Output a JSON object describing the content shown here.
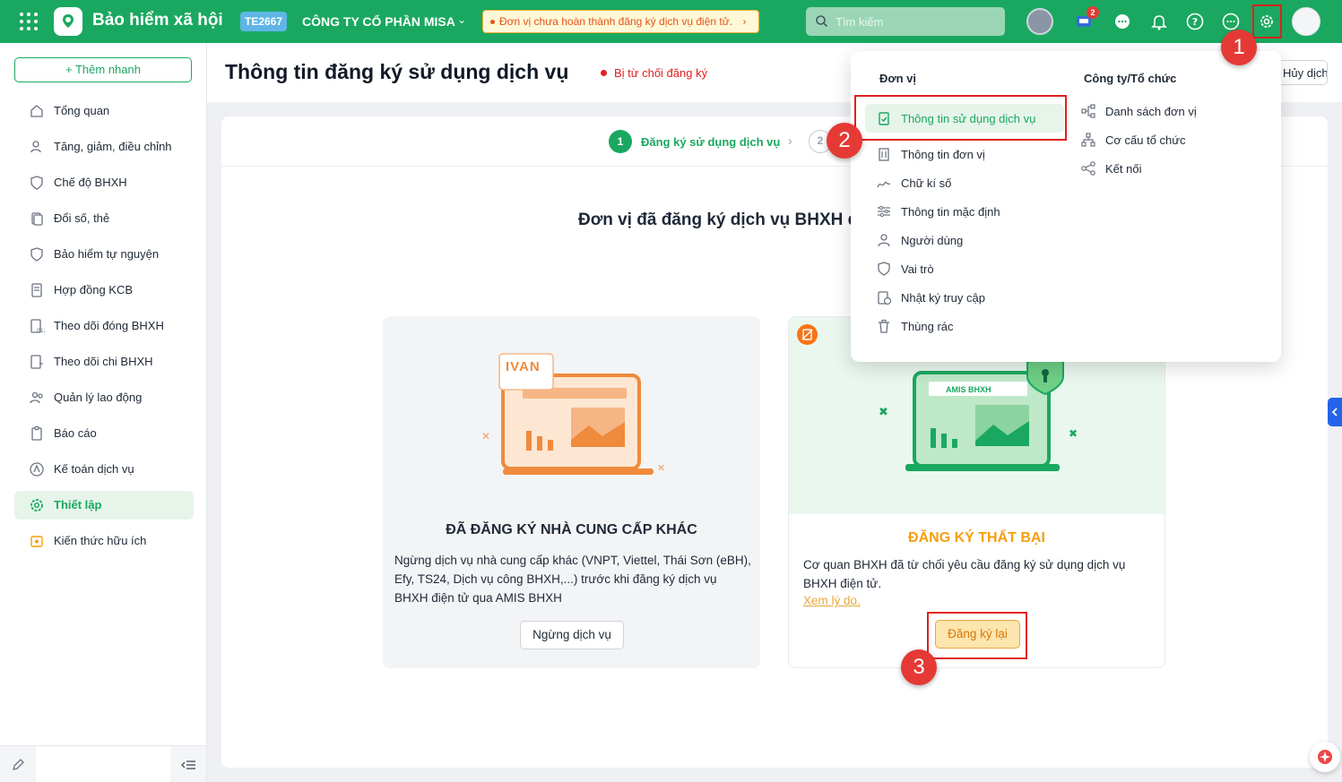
{
  "topbar": {
    "app_title": "Bảo hiểm xã hội",
    "org_code": "TE2667",
    "org_name": "CÔNG TY CỔ PHẦN MISA",
    "warning": "Đơn vị chưa hoàn thành đăng ký dịch vụ điện tử.",
    "search_placeholder": "Tìm kiếm",
    "cart_badge": "2",
    "brand_color": "#1aa860"
  },
  "sidebar": {
    "quick_add": "Thêm nhanh",
    "items": [
      {
        "label": "Tổng quan",
        "icon": "home-icon"
      },
      {
        "label": "Tăng, giảm, điều chỉnh",
        "icon": "user-adjust-icon"
      },
      {
        "label": "Chế độ BHXH",
        "icon": "shield-heart-icon"
      },
      {
        "label": "Đổi số, thẻ",
        "icon": "card-swap-icon"
      },
      {
        "label": "Bảo hiểm tự nguyện",
        "icon": "shield-icon"
      },
      {
        "label": "Hợp đồng KCB",
        "icon": "contract-icon"
      },
      {
        "label": "Theo dõi đóng BHXH",
        "icon": "payment-track-icon"
      },
      {
        "label": "Theo dõi chi BHXH",
        "icon": "expense-track-icon"
      },
      {
        "label": "Quản lý lao động",
        "icon": "people-icon"
      },
      {
        "label": "Báo cáo",
        "icon": "report-icon"
      },
      {
        "label": "Kế toán dịch vụ",
        "icon": "accounting-icon"
      },
      {
        "label": "Thiết lập",
        "icon": "gear-icon"
      },
      {
        "label": "Kiến thức hữu ích",
        "icon": "knowledge-icon"
      }
    ]
  },
  "header": {
    "title": "Thông tin đăng ký sử dụng dịch vụ",
    "status": "Bị từ chối đăng ký",
    "right_button": "Hủy dịch vụ"
  },
  "stepper": {
    "step1_num": "1",
    "step1_label": "Đăng ký sử dụng dịch vụ",
    "step2_num": "2"
  },
  "content": {
    "heading": "Đơn vị đã đăng ký dịch vụ BHXH điện tử",
    "left_panel": {
      "tag": "IVAN",
      "title": "ĐÃ ĐĂNG KÝ NHÀ CUNG CẤP KHÁC",
      "text": "Ngừng dịch vụ nhà cung cấp khác (VNPT, Viettel, Thái Sơn (eBH), Efy, TS24, Dịch vụ công BHXH,...) trước khi đăng ký dịch vụ BHXH điện tử qua AMIS BHXH",
      "button": "Ngừng dịch vụ"
    },
    "right_panel": {
      "screen_label": "AMIS BHXH",
      "title": "ĐĂNG KÝ THẤT BẠI",
      "text": "Cơ quan BHXH đã từ chối yêu cầu đăng ký sử dụng dịch vụ BHXH điện tử.",
      "link": "Xem lý do.",
      "button": "Đăng ký lại"
    }
  },
  "menu": {
    "col1_title": "Đơn vị",
    "col1_items": [
      {
        "label": "Thông tin sử dụng dịch vụ",
        "icon": "clipboard-check-icon",
        "selected": true
      },
      {
        "label": "Thông tin đơn vị",
        "icon": "building-icon"
      },
      {
        "label": "Chữ kí số",
        "icon": "signature-icon"
      },
      {
        "label": "Thông tin mặc định",
        "icon": "sliders-icon"
      },
      {
        "label": "Người dùng",
        "icon": "user-icon"
      },
      {
        "label": "Vai trò",
        "icon": "shield-icon"
      },
      {
        "label": "Nhật ký truy cập",
        "icon": "log-icon"
      },
      {
        "label": "Thùng rác",
        "icon": "trash-icon"
      }
    ],
    "col2_title": "Công ty/Tổ chức",
    "col2_items": [
      {
        "label": "Danh sách đơn vị",
        "icon": "org-list-icon"
      },
      {
        "label": "Cơ cấu tổ chức",
        "icon": "org-structure-icon"
      },
      {
        "label": "Kết nối",
        "icon": "share-icon"
      }
    ]
  },
  "callouts": [
    "1",
    "2",
    "3"
  ]
}
